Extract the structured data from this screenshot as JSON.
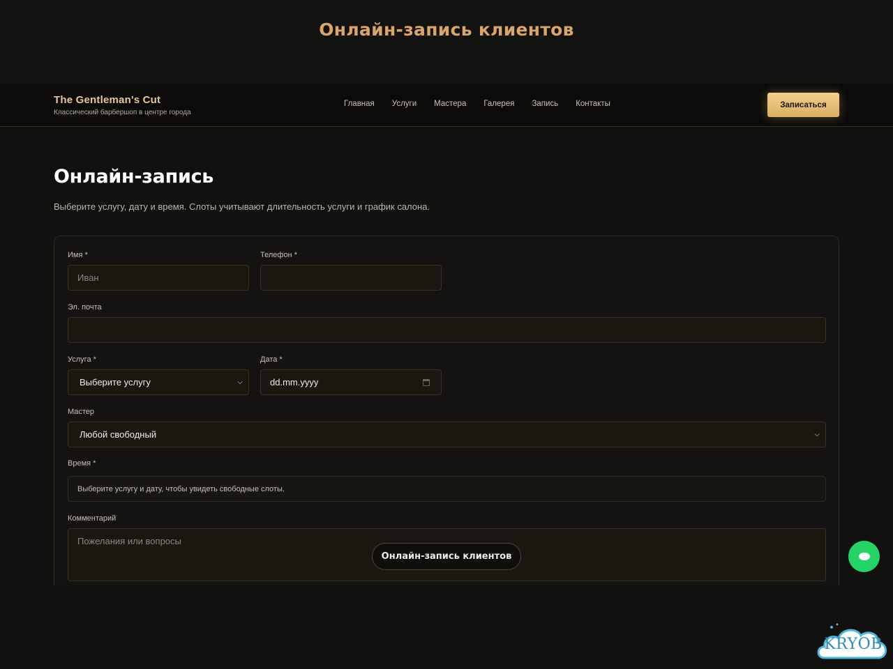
{
  "banner": {
    "title": "Онлайн-запись клиентов"
  },
  "header": {
    "brand_title": "The Gentleman's Cut",
    "brand_tagline": "Классический барбершоп в центре города",
    "nav": [
      "Главная",
      "Услуги",
      "Мастера",
      "Галерея",
      "Запись",
      "Контакты"
    ],
    "cta_label": "Записаться"
  },
  "main": {
    "title": "Онлайн-запись",
    "subtitle": "Выберите услугу, дату и время. Слоты учитывают длительность услуги и график салона."
  },
  "form": {
    "name_label": "Имя *",
    "name_placeholder": "Иван",
    "phone_label": "Телефон *",
    "phone_value": "",
    "email_label": "Эл. почта",
    "email_value": "",
    "service_label": "Услуга *",
    "service_value": "Выберите услугу",
    "date_label": "Дата *",
    "date_placeholder": "dd.mm.yyyy",
    "master_label": "Мастер",
    "master_value": "Любой свободный",
    "time_label": "Время *",
    "time_hint": "Выберите услугу и дату, чтобы увидеть свободные слоты.",
    "comment_label": "Комментарий",
    "comment_placeholder": "Пожелания или вопросы"
  },
  "floating_pill": {
    "label": "Онлайн-запись клиентов"
  },
  "chat_button": {
    "icon": "chat-icon",
    "color": "#25d366"
  },
  "watermark": {
    "text": "KRYOB"
  },
  "colors": {
    "accent": "#d9a56c",
    "cta_gradient_top": "#f1d18d",
    "cta_gradient_bottom": "#dcae62",
    "background": "#111110",
    "field_bg": "#1b160f"
  }
}
